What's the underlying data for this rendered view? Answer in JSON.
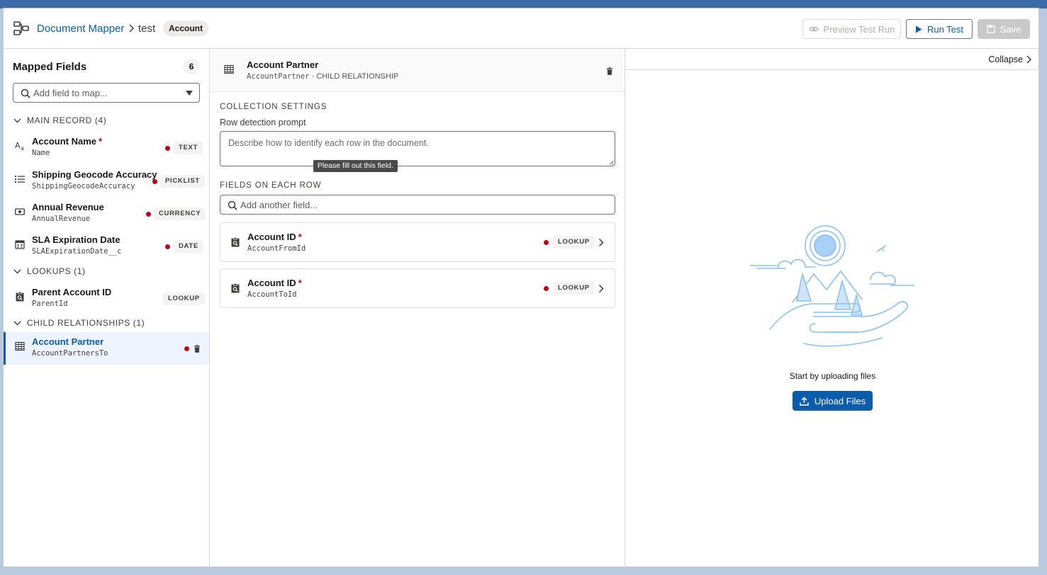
{
  "header": {
    "app_name": "Document Mapper",
    "breadcrumb_record": "test",
    "object_pill": "Account",
    "preview_label": "Preview Test Run",
    "run_label": "Run Test",
    "save_label": "Save"
  },
  "left": {
    "title": "Mapped Fields",
    "count": "6",
    "search_placeholder": "Add field to map...",
    "sections": {
      "main": "MAIN RECORD (4)",
      "lookups": "LOOKUPS (1)",
      "children": "CHILD RELATIONSHIPS (1)"
    },
    "fields": [
      {
        "label": "Account Name",
        "api": "Name",
        "type": "TEXT",
        "required": "*",
        "icon": "text-icon"
      },
      {
        "label": "Shipping Geocode Accuracy",
        "api": "ShippingGeocodeAccuracy",
        "type": "PICKLIST",
        "icon": "list-icon"
      },
      {
        "label": "Annual Revenue",
        "api": "AnnualRevenue",
        "type": "CURRENCY",
        "icon": "currency-icon"
      },
      {
        "label": "SLA Expiration Date",
        "api": "SLAExpirationDate__c",
        "type": "DATE",
        "icon": "calendar-icon"
      }
    ],
    "lookups": [
      {
        "label": "Parent Account ID",
        "api": "ParentId",
        "type": "LOOKUP",
        "icon": "lookup-icon"
      }
    ],
    "children": [
      {
        "label": "Account Partner",
        "api": "AccountPartnersTo",
        "icon": "table-icon"
      }
    ]
  },
  "middle": {
    "title": "Account Partner",
    "subtitle_api": "AccountPartner",
    "subtitle_kind": " · CHILD RELATIONSHIP",
    "collection_settings": "COLLECTION SETTINGS",
    "row_prompt_label": "Row detection prompt",
    "row_prompt_placeholder": "Describe how to identify each row in the document.",
    "tooltip": "Please fill out this field.",
    "fields_on_row": "FIELDS ON EACH ROW",
    "add_another_placeholder": "Add another field...",
    "row_fields": [
      {
        "label": "Account ID",
        "required": "*",
        "api": "AccountFromId",
        "type": "LOOKUP"
      },
      {
        "label": "Account ID",
        "required": "*",
        "api": "AccountToId",
        "type": "LOOKUP"
      }
    ]
  },
  "right": {
    "collapse_label": "Collapse",
    "empty_text": "Start by uploading files",
    "upload_label": "Upload Files"
  },
  "colors": {
    "brand": "#0b5cab",
    "required_dot": "#ba0517",
    "illustration": "#8cc0ef"
  }
}
